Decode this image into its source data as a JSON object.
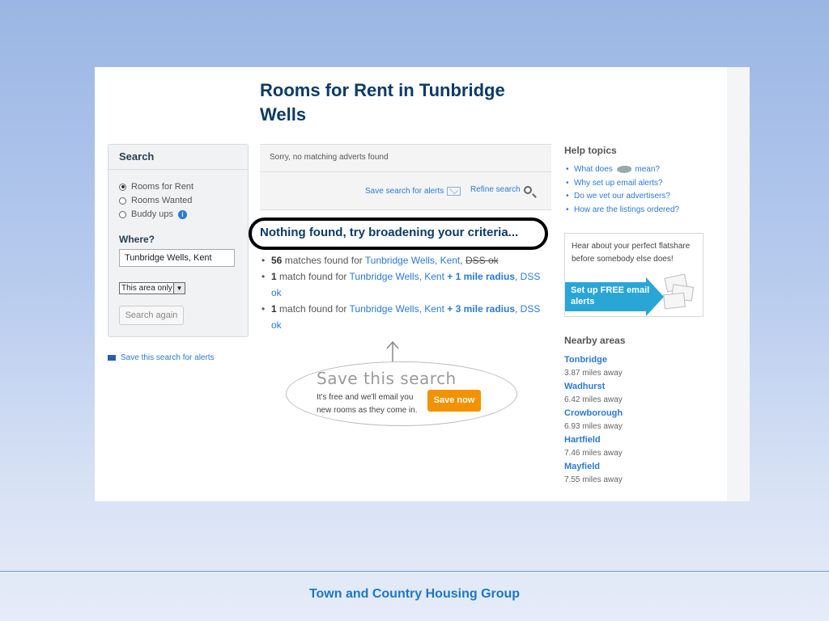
{
  "page": {
    "title": "Rooms for Rent in Tunbridge Wells",
    "footer": "Town and Country Housing Group"
  },
  "search": {
    "header": "Search",
    "options": [
      "Rooms for Rent",
      "Rooms Wanted",
      "Buddy ups"
    ],
    "selected": "Rooms for Rent",
    "where_label": "Where?",
    "where_value": "Tunbridge Wells, Kent",
    "area_select": "This area only",
    "search_again": "Search again",
    "save_link": "Save this search for alerts"
  },
  "results_header": {
    "no_match": "Sorry, no matching adverts found",
    "save_alerts": "Save search for alerts",
    "refine": "Refine search"
  },
  "nothing_found": "Nothing found, try broadening your criteria...",
  "suggestions": [
    {
      "count": "56",
      "text": " matches found for ",
      "place": "Tunbridge Wells, Kent",
      "extra": "",
      "tail": "DSS ok"
    },
    {
      "count": "1",
      "text": " match found for ",
      "place": "Tunbridge Wells, Kent",
      "extra": "+ 1 mile radius",
      "tail": "DSS ok"
    },
    {
      "count": "1",
      "text": " match found for ",
      "place": "Tunbridge Wells, Kent",
      "extra": "+ 3 mile radius",
      "tail": "DSS ok"
    }
  ],
  "save_promo": {
    "title": "Save this search",
    "text": "It's free and we'll email you new rooms as they come in.",
    "button": "Save now"
  },
  "help": {
    "title": "Help topics",
    "items": [
      "What does",
      "mean?",
      "Why set up email alerts?",
      "Do we vet our advertisers?",
      "How are the listings ordered?"
    ]
  },
  "alerts": {
    "text": "Hear about your perfect flatshare before somebody else does!",
    "cta": "Set up FREE email alerts"
  },
  "nearby": {
    "title": "Nearby areas",
    "areas": [
      {
        "name": "Tonbridge",
        "distance": "3.87 miles away"
      },
      {
        "name": "Wadhurst",
        "distance": "6.42 miles away"
      },
      {
        "name": "Crowborough",
        "distance": "6.93 miles away"
      },
      {
        "name": "Hartfield",
        "distance": "7.46 miles away"
      },
      {
        "name": "Mayfield",
        "distance": "7.55 miles away"
      }
    ]
  }
}
